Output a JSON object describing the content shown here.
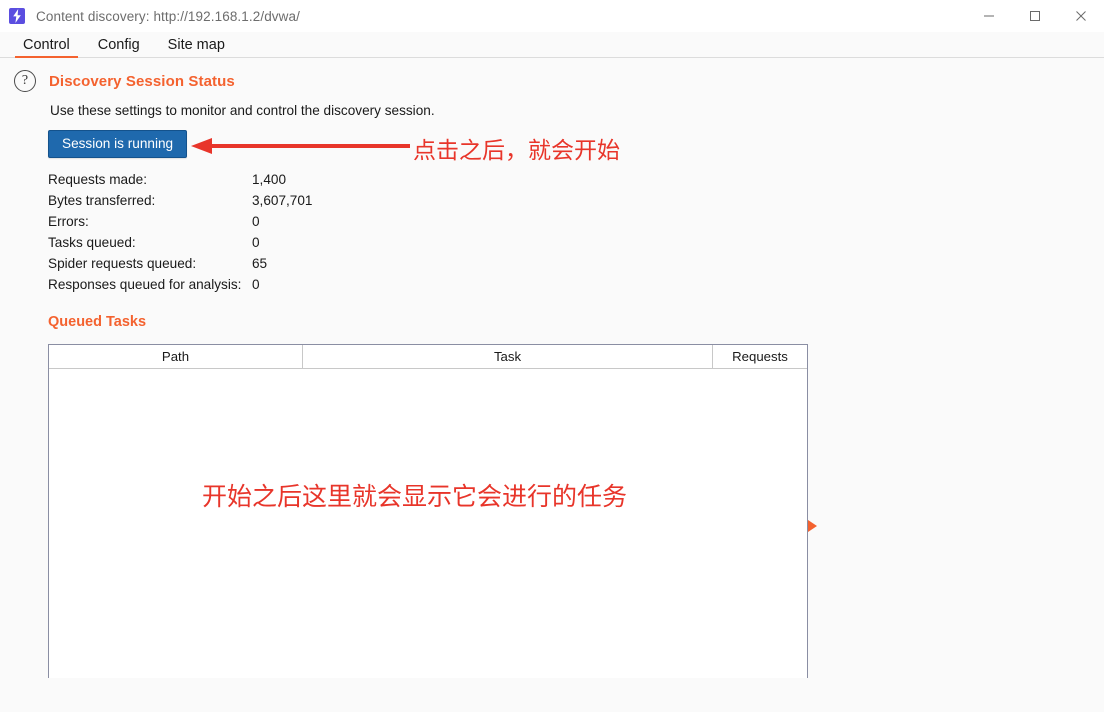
{
  "window": {
    "title": "Content discovery: http://192.168.1.2/dvwa/",
    "app_icon": "lightning-bolt-icon",
    "controls": {
      "minimize": "minimize-icon",
      "maximize": "maximize-icon",
      "close": "close-icon"
    }
  },
  "tabs": [
    {
      "label": "Control",
      "active": true
    },
    {
      "label": "Config",
      "active": false
    },
    {
      "label": "Site map",
      "active": false
    }
  ],
  "section": {
    "help_icon": "question-mark-icon",
    "title": "Discovery Session Status",
    "description": "Use these settings to monitor and control the discovery session.",
    "button_label": "Session is running",
    "accent_color": "#f4622f",
    "button_color": "#1f69ad"
  },
  "stats": [
    {
      "label": "Requests made:",
      "value": "1,400"
    },
    {
      "label": "Bytes transferred:",
      "value": "3,607,701"
    },
    {
      "label": "Errors:",
      "value": "0"
    },
    {
      "label": "Tasks queued:",
      "value": "0"
    },
    {
      "label": "Spider requests queued:",
      "value": "65"
    },
    {
      "label": "Responses queued for analysis:",
      "value": "0"
    }
  ],
  "queued_tasks": {
    "title": "Queued Tasks",
    "columns": [
      "Path",
      "Task",
      "Requests"
    ],
    "rows": []
  },
  "annotations": {
    "click_note": "点击之后，就会开始",
    "tasks_note": "开始之后这里就会显示它会进行的任务",
    "arrow_color": "#e8352a",
    "marker_color": "#f4622f"
  }
}
